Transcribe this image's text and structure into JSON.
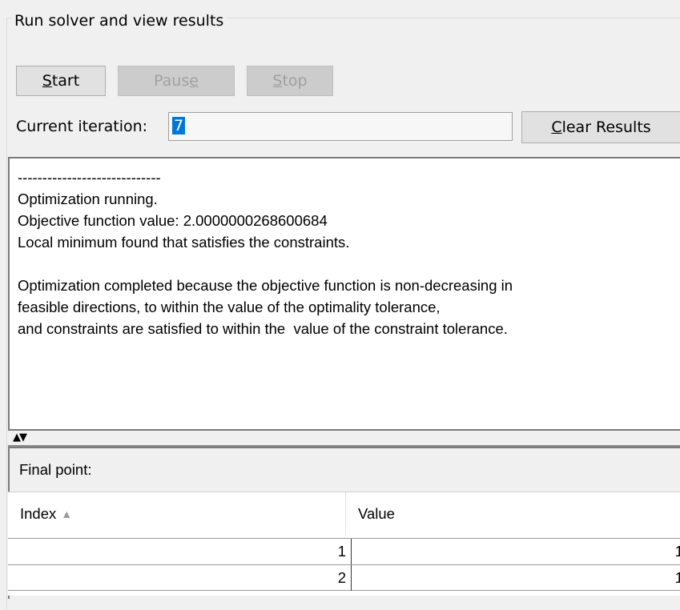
{
  "group": {
    "title": "Run solver and view results"
  },
  "buttons": {
    "start": {
      "label_pre": "",
      "label_u": "S",
      "label_post": "tart"
    },
    "pause": {
      "label_pre": "Paus",
      "label_u": "e",
      "label_post": ""
    },
    "stop": {
      "label_pre": "",
      "label_u": "S",
      "label_post": "top"
    },
    "clear": {
      "label_pre": "",
      "label_u": "C",
      "label_post": "lear Results"
    }
  },
  "iteration": {
    "label": "Current iteration:",
    "value": "7"
  },
  "log": {
    "text": "-----------------------------\nOptimization running.\nObjective function value: 2.0000000268600684\nLocal minimum found that satisfies the constraints.\n\nOptimization completed because the objective function is non-decreasing in\nfeasible directions, to within the value of the optimality tolerance,\nand constraints are satisfied to within the  value of the constraint tolerance."
  },
  "splitter": {
    "glyph": "▲▼"
  },
  "final_point": {
    "label": "Final point:",
    "columns": [
      "Index",
      "Value"
    ],
    "sort_glyph": "▲",
    "rows": [
      {
        "index": "1",
        "value": "1"
      },
      {
        "index": "2",
        "value": "1"
      }
    ]
  }
}
